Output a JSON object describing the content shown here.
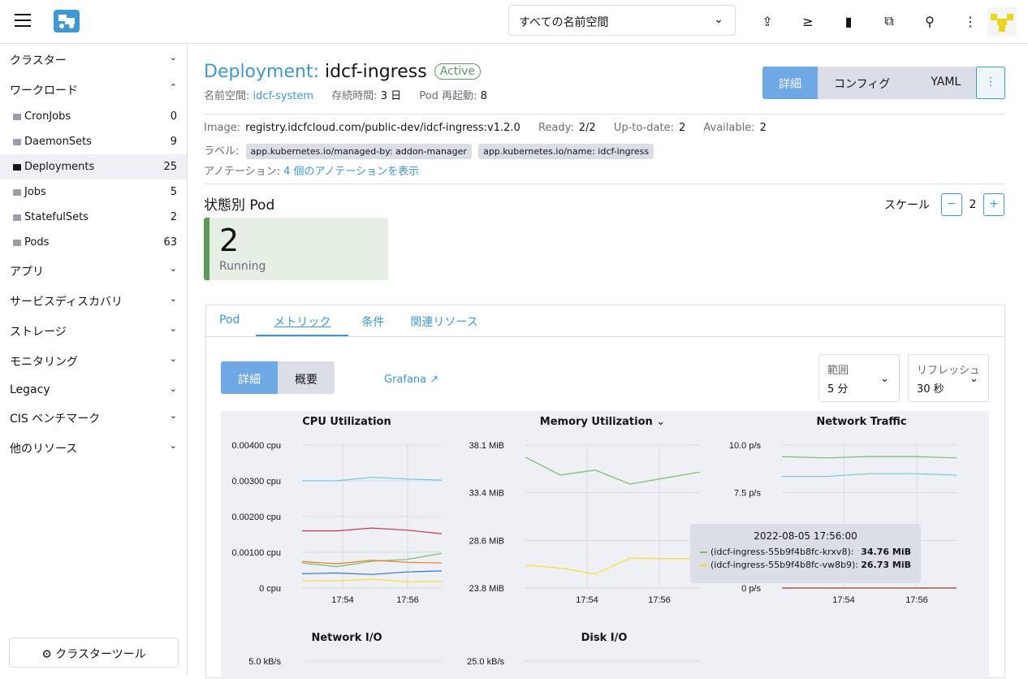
{
  "header": {
    "namespace_select": "すべての名前空間",
    "icons": [
      "upload-icon",
      "terminal-icon",
      "file-icon",
      "copy-icon",
      "search-icon",
      "more-vertical-icon"
    ]
  },
  "sidebar": {
    "groups_top": [
      {
        "label": "クラスター",
        "expanded": false
      },
      {
        "label": "ワークロード",
        "expanded": true
      }
    ],
    "items": [
      {
        "label": "CronJobs",
        "count": "0"
      },
      {
        "label": "DaemonSets",
        "count": "9"
      },
      {
        "label": "Deployments",
        "count": "25",
        "active": true
      },
      {
        "label": "Jobs",
        "count": "5"
      },
      {
        "label": "StatefulSets",
        "count": "2"
      },
      {
        "label": "Pods",
        "count": "63"
      }
    ],
    "groups_bottom": [
      {
        "label": "アプリ"
      },
      {
        "label": "サービスディスカバリ"
      },
      {
        "label": "ストレージ"
      },
      {
        "label": "モニタリング"
      },
      {
        "label": "Legacy"
      },
      {
        "label": "CIS ベンチマーク"
      },
      {
        "label": "他のリソース"
      }
    ],
    "cluster_tools": "クラスターツール"
  },
  "resource": {
    "kind": "Deployment:",
    "name": "idcf-ingress",
    "status": "Active",
    "namespace_label": "名前空間:",
    "namespace": "idcf-system",
    "age_label": "存続時間:",
    "age": "3 日",
    "restarts_label": "Pod 再起動:",
    "restarts": "8"
  },
  "view_tabs": [
    "詳細",
    "コンフィグ",
    "YAML"
  ],
  "details": {
    "image_label": "Image:",
    "image": "registry.idcfcloud.com/public-dev/idcf-ingress:v1.2.0",
    "ready_label": "Ready:",
    "ready": "2/2",
    "uptodate_label": "Up-to-date:",
    "uptodate": "2",
    "available_label": "Available:",
    "available": "2",
    "labels_label": "ラベル:",
    "labels": [
      "app.kubernetes.io/managed-by: addon-manager",
      "app.kubernetes.io/name: idcf-ingress"
    ],
    "annotations_label": "アノテーション:",
    "annotations_link": "4 個のアノテーションを表示"
  },
  "pods": {
    "title": "状態別 Pod",
    "scale_label": "スケール",
    "scale_value": "2",
    "running_count": "2",
    "running_label": "Running"
  },
  "panel_tabs": [
    "Pod",
    "メトリック",
    "条件",
    "関連リソース"
  ],
  "metrics": {
    "mode_buttons": [
      "詳細",
      "概要"
    ],
    "grafana": "Grafana",
    "range_label": "範囲",
    "range_value": "5 分",
    "refresh_label": "リフレッシュ",
    "refresh_value": "30 秒"
  },
  "chart_data": [
    {
      "type": "line",
      "title": "CPU Utilization",
      "x": [
        "17:53",
        "17:54",
        "17:55",
        "17:56",
        "17:57"
      ],
      "yticks": [
        "0.00400 cpu",
        "0.00300 cpu",
        "0.00200 cpu",
        "0.00100 cpu",
        "0 cpu"
      ],
      "xticks": [
        "17:54",
        "17:56"
      ],
      "ylim": [
        0,
        0.004
      ],
      "series": [
        {
          "color": "#74c7e0",
          "values": [
            0.003,
            0.003,
            0.0031,
            0.00305,
            0.00302
          ]
        },
        {
          "color": "#e02f44",
          "values": [
            0.0016,
            0.0016,
            0.00168,
            0.00162,
            0.00152
          ]
        },
        {
          "color": "#73bf69",
          "values": [
            0.0007,
            0.0006,
            0.00075,
            0.0008,
            0.00097
          ]
        },
        {
          "color": "#ff780a",
          "values": [
            0.00074,
            0.00068,
            0.00078,
            0.00072,
            0.0007
          ]
        },
        {
          "color": "#3274d9",
          "values": [
            0.0004,
            0.00042,
            0.00038,
            0.00045,
            0.00048
          ]
        },
        {
          "color": "#fade2a",
          "values": [
            0.0002,
            0.0002,
            0.00025,
            0.00018,
            0.00018
          ]
        }
      ]
    },
    {
      "type": "line",
      "title": "Memory Utilization",
      "x": [
        "17:53",
        "17:54",
        "17:55",
        "17:56",
        "17:57"
      ],
      "yticks": [
        "38.1 MiB",
        "33.4 MiB",
        "28.6 MiB",
        "23.8 MiB"
      ],
      "xticks": [
        "17:54",
        "17:56"
      ],
      "ylim": [
        23.8,
        38.1
      ],
      "series": [
        {
          "name": "(idcf-ingress-55b9f4b8fc-krxv8):",
          "color": "#73bf69",
          "values": [
            36.9,
            35.1,
            35.6,
            34.2,
            34.8,
            35.4
          ]
        },
        {
          "name": "(idcf-ingress-55b9f4b8fc-vw8b9):",
          "color": "#fade2a",
          "values": [
            26.1,
            25.8,
            25.2,
            26.8,
            26.73,
            26.73
          ]
        }
      ],
      "tooltip": {
        "time": "2022-08-05 17:56:00",
        "values": [
          "34.76 MiB",
          "26.73 MiB"
        ]
      }
    },
    {
      "type": "line",
      "title": "Network Traffic",
      "x": [
        "17:53",
        "17:54",
        "17:55",
        "17:56",
        "17:57"
      ],
      "yticks": [
        "10.0 p/s",
        "7.5 p/s",
        "5.0 p/s",
        "0 p/s"
      ],
      "xticks": [
        "17:54",
        "17:56"
      ],
      "ylim": [
        0,
        10
      ],
      "series": [
        {
          "color": "#73bf69",
          "values": [
            9.2,
            9.1,
            9.2,
            9.2,
            9.1
          ]
        },
        {
          "color": "#74c7e0",
          "values": [
            7.8,
            7.8,
            8.0,
            8.0,
            7.9
          ]
        },
        {
          "color": "#8a3f1a",
          "values": [
            0,
            0,
            0,
            0,
            0
          ]
        }
      ]
    },
    {
      "type": "line",
      "title": "Network I/O",
      "yticks": [
        "5.0 kB/s"
      ]
    },
    {
      "type": "line",
      "title": "Disk I/O",
      "yticks": [
        "25.0 kB/s"
      ]
    }
  ]
}
